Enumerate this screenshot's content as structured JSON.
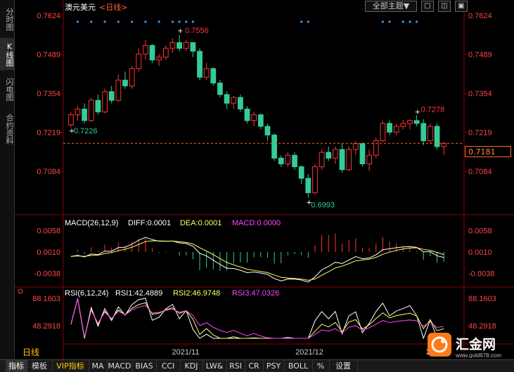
{
  "sidebar": {
    "tabs": [
      {
        "label": "分时图"
      },
      {
        "label": "K线图"
      },
      {
        "label": "闪电图"
      },
      {
        "label": "合约资料"
      }
    ]
  },
  "header": {
    "symbol": "澳元美元",
    "period": "<日线>",
    "theme_button": "全部主题▼",
    "win_buttons": [
      "□",
      "◫",
      "▣"
    ]
  },
  "price_axis": {
    "labels": [
      "0.7624",
      "0.7489",
      "0.7354",
      "0.7219",
      "0.7084"
    ],
    "values": [
      0.7624,
      0.7489,
      0.7354,
      0.7219,
      0.7084
    ]
  },
  "current_price": "0.7181",
  "annotations": {
    "high": "0.7556",
    "low": "0.6993",
    "local_high": "0.7278",
    "left_label": "0.7226"
  },
  "macd": {
    "title": "MACD(26,12,9)",
    "diff": "DIFF:0.0001",
    "dea": "DEA:0.0001",
    "macd": "MACD:0.0000",
    "axis_labels": [
      "0.0058",
      "0.0010",
      "-0.0038"
    ],
    "axis_values": [
      0.0058,
      0.001,
      -0.0038
    ]
  },
  "rsi": {
    "title": "RSI(6,12,24)",
    "rsi1": "RSI1:42.4889",
    "rsi2": "RSI2:46.9748",
    "rsi3": "RSI3:47.0326",
    "axis_labels": [
      "88.1603",
      "48.2918"
    ],
    "axis_values": [
      88.1603,
      48.2918
    ]
  },
  "date_labels": [
    "2021/11",
    "2021/12",
    "20"
  ],
  "range_label": "日线",
  "bottom_tabs": [
    "指标",
    "模板",
    "VIP指标",
    "MA",
    "MACD",
    "BIAS",
    "CCI",
    "KDJ",
    "LW&",
    "RSI",
    "CR",
    "PSY",
    "BOLL",
    "%",
    "设置"
  ],
  "logo": {
    "text": "汇金网",
    "url": "www.gold678.com"
  },
  "colors": {
    "up": "#ff3333",
    "down": "#33cc99",
    "accent": "#ff6633",
    "axis_text": "#ff4444",
    "grid": "#8b0000"
  },
  "chart_data": {
    "type": "candlestick",
    "ohlc": [
      [
        0.7245,
        0.729,
        0.7236,
        0.728
      ],
      [
        0.728,
        0.731,
        0.726,
        0.73
      ],
      [
        0.73,
        0.732,
        0.725,
        0.726
      ],
      [
        0.726,
        0.734,
        0.7255,
        0.733
      ],
      [
        0.733,
        0.735,
        0.728,
        0.729
      ],
      [
        0.729,
        0.737,
        0.7285,
        0.736
      ],
      [
        0.736,
        0.738,
        0.732,
        0.733
      ],
      [
        0.733,
        0.742,
        0.7325,
        0.74
      ],
      [
        0.74,
        0.743,
        0.737,
        0.738
      ],
      [
        0.738,
        0.745,
        0.737,
        0.744
      ],
      [
        0.744,
        0.751,
        0.743,
        0.749
      ],
      [
        0.749,
        0.754,
        0.747,
        0.752
      ],
      [
        0.752,
        0.7525,
        0.746,
        0.747
      ],
      [
        0.747,
        0.749,
        0.745,
        0.748
      ],
      [
        0.748,
        0.752,
        0.747,
        0.751
      ],
      [
        0.751,
        0.7545,
        0.7495,
        0.753
      ],
      [
        0.753,
        0.7556,
        0.75,
        0.751
      ],
      [
        0.751,
        0.754,
        0.75,
        0.753
      ],
      [
        0.753,
        0.7532,
        0.748,
        0.75
      ],
      [
        0.75,
        0.751,
        0.74,
        0.741
      ],
      [
        0.741,
        0.746,
        0.74,
        0.744
      ],
      [
        0.744,
        0.7445,
        0.738,
        0.739
      ],
      [
        0.739,
        0.74,
        0.734,
        0.735
      ],
      [
        0.735,
        0.736,
        0.73,
        0.732
      ],
      [
        0.732,
        0.7345,
        0.73,
        0.734
      ],
      [
        0.734,
        0.735,
        0.729,
        0.73
      ],
      [
        0.73,
        0.731,
        0.725,
        0.726
      ],
      [
        0.726,
        0.729,
        0.724,
        0.728
      ],
      [
        0.728,
        0.7285,
        0.723,
        0.724
      ],
      [
        0.724,
        0.725,
        0.719,
        0.721
      ],
      [
        0.721,
        0.7215,
        0.712,
        0.713
      ],
      [
        0.713,
        0.714,
        0.71,
        0.711
      ],
      [
        0.711,
        0.715,
        0.71,
        0.714
      ],
      [
        0.714,
        0.715,
        0.709,
        0.71
      ],
      [
        0.71,
        0.7105,
        0.704,
        0.706
      ],
      [
        0.706,
        0.7075,
        0.6993,
        0.701
      ],
      [
        0.701,
        0.711,
        0.7005,
        0.71
      ],
      [
        0.71,
        0.716,
        0.709,
        0.715
      ],
      [
        0.715,
        0.717,
        0.712,
        0.713
      ],
      [
        0.713,
        0.717,
        0.711,
        0.716
      ],
      [
        0.716,
        0.718,
        0.708,
        0.709
      ],
      [
        0.709,
        0.717,
        0.7085,
        0.716
      ],
      [
        0.716,
        0.719,
        0.714,
        0.718
      ],
      [
        0.718,
        0.7185,
        0.71,
        0.711
      ],
      [
        0.711,
        0.716,
        0.7085,
        0.714
      ],
      [
        0.714,
        0.72,
        0.713,
        0.719
      ],
      [
        0.719,
        0.726,
        0.7185,
        0.725
      ],
      [
        0.725,
        0.726,
        0.721,
        0.722
      ],
      [
        0.722,
        0.725,
        0.721,
        0.724
      ],
      [
        0.724,
        0.7262,
        0.723,
        0.725
      ],
      [
        0.725,
        0.7265,
        0.723,
        0.726
      ],
      [
        0.726,
        0.7278,
        0.724,
        0.725
      ],
      [
        0.725,
        0.7265,
        0.7175,
        0.719
      ],
      [
        0.719,
        0.725,
        0.718,
        0.724
      ],
      [
        0.724,
        0.725,
        0.716,
        0.717
      ],
      [
        0.717,
        0.7185,
        0.714,
        0.7181
      ]
    ]
  }
}
